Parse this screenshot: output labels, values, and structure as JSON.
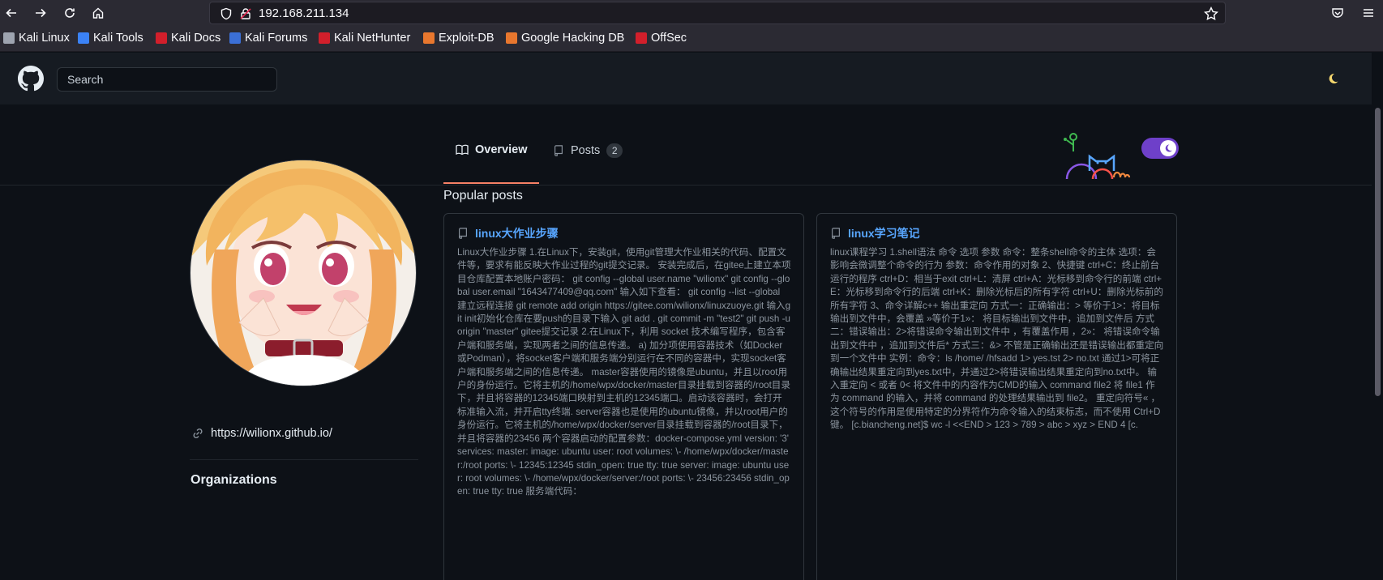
{
  "browser": {
    "url": "192.168.211.134",
    "bookmarks": [
      {
        "label": "Kali Linux",
        "color": "#9ea4b0"
      },
      {
        "label": "Kali Tools",
        "color": "#3b82f6"
      },
      {
        "label": "Kali Docs",
        "color": "#d21f2b"
      },
      {
        "label": "Kali Forums",
        "color": "#3b6fd6"
      },
      {
        "label": "Kali NetHunter",
        "color": "#d21f2b"
      },
      {
        "label": "Exploit-DB",
        "color": "#e8772e"
      },
      {
        "label": "Google Hacking DB",
        "color": "#e8772e"
      },
      {
        "label": "OffSec",
        "color": "#d21f2b"
      }
    ]
  },
  "header": {
    "search_placeholder": "Search"
  },
  "tabs": {
    "overview_label": "Overview",
    "posts_label": "Posts",
    "posts_count": "2"
  },
  "profile": {
    "website": "https://wilionx.github.io/",
    "organizations_title": "Organizations"
  },
  "main": {
    "popular_title": "Popular posts",
    "posts": [
      {
        "title": "linux大作业步骤",
        "excerpt": "Linux大作业步骤 1.在Linux下，安装git，使用git管理大作业相关的代码、配置文件等，要求有能反映大作业过程的git提交记录。 安装完成后，在gitee上建立本项目仓库配置本地账户密码： git config --global user.name \"wilionx\" git config --global user.email \"1643477409@qq.com\" 输入如下查看： git config --list --global 建立远程连接 git remote add origin https://gitee.com/wilionx/linuxzuoye.git 输入git init初始化仓库在要push的目录下输入 git add . git commit -m \"test2\" git push -u origin \"master\" gitee提交记录 2.在Linux下，利用 socket 技术编写程序，包含客户端和服务端，实现两者之间的信息传递。 a) 加分项使用容器技术（如Docker或Podman），将socket客户端和服务端分别运行在不同的容器中，实现socket客户端和服务端之间的信息传递。 master容器使用的镜像是ubuntu，并且以root用户的身份运行。它将主机的/home/wpx/docker/master目录挂载到容器的/root目录下，并且将容器的12345端口映射到主机的12345端口。启动该容器时，会打开标准输入流，并开启tty终端. server容器也是使用的ubuntu镜像，并以root用户的身份运行。它将主机的/home/wpx/docker/server目录挂载到容器的/root目录下，并且将容器的23456 两个容器启动的配置参数：docker-compose.yml version: '3' services: master: image: ubuntu user: root volumes: \\- /home/wpx/docker/master:/root ports: \\- 12345:12345 stdin_open: true tty: true server: image: ubuntu user: root volumes: \\- /home/wpx/docker/server:/root ports: \\- 23456:23456 stdin_open: true tty: true 服务端代码："
      },
      {
        "title": "linux学习笔记",
        "excerpt": "linux课程学习 1.shell语法 命令 选项 参数 命令：整条shell命令的主体 选项：会影响会微调整个命令的行为 参数：命令作用的对象 2、快捷键 ctrl+C：终止前台运行的程序 ctrl+D：相当于exit ctrl+L：清屏 ctrl+A：光标移到命令行的前端 ctrl+E：光标移到命令行的后端 ctrl+K：删除光标后的所有字符 ctrl+U：删除光标前的所有字符 3、命令详解c++ 输出重定向 方式一：正确输出：> 等价于1>：将目标输出到文件中，会覆盖 »等价于1»： 将目标输出到文件中，追加到文件后 方式二：错误输出：2>将错误命令输出到文件中 ，有覆盖作用 ，2»： 将错误命令输出到文件中 ，追加到文件后* 方式三：&> 不管是正确输出还是错误输出都重定向到一个文件中 实例：命令：ls /home/ /hfsadd 1> yes.tst 2> no.txt 通过1>可将正确输出结果重定向到yes.txt中，并通过2>将错误输出结果重定向到no.txt中。 输入重定向 < 或者 0< 将文件中的内容作为CMD的输入 command file2 将 file1 作为 command 的输入，并将 command 的处理结果输出到 file2。 重定向符号« ，这个符号的作用是使用特定的分界符作为命令输入的结束标志，而不使用 Ctrl+D 键。 [c.biancheng.net]$ wc -l <<END > 123 > 789 > abc > xyz > END 4 [c."
      }
    ]
  }
}
